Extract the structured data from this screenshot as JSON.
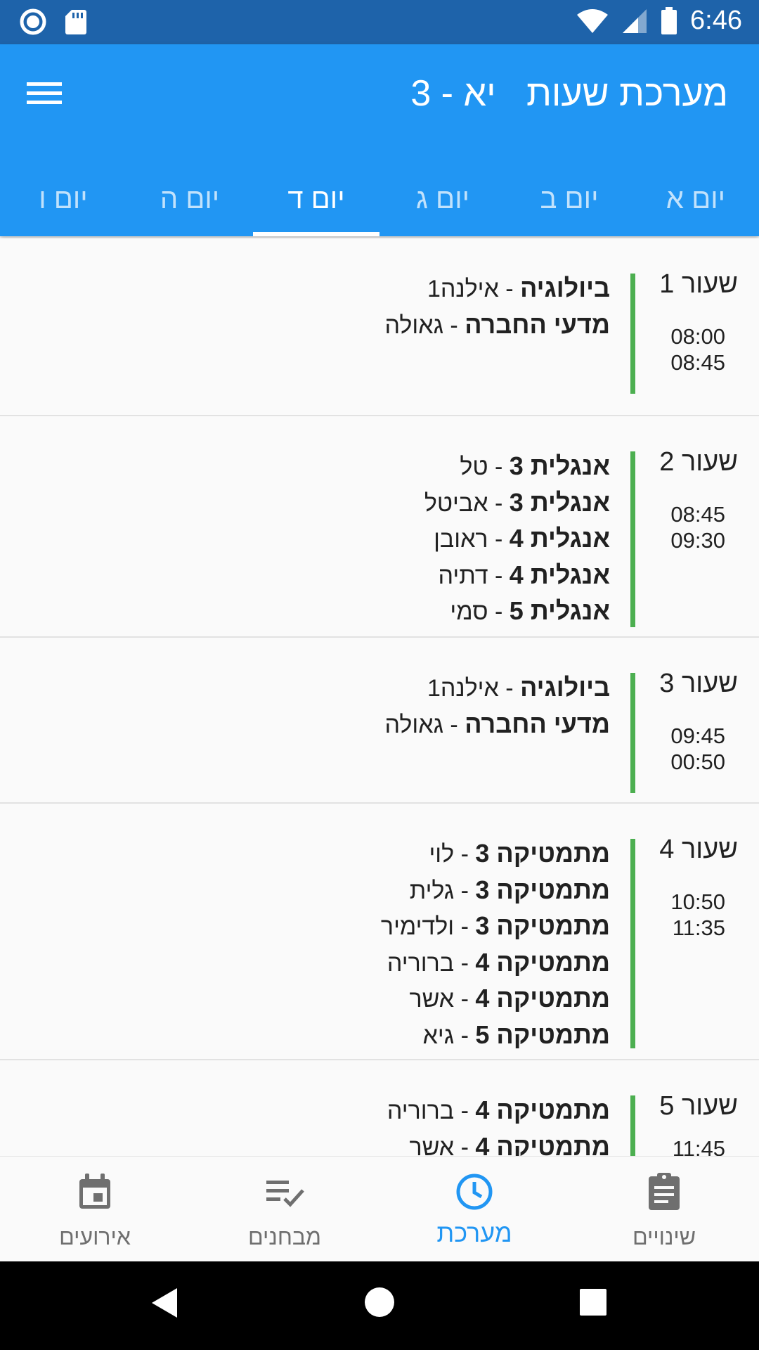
{
  "status_bar": {
    "time": "6:46"
  },
  "app_bar": {
    "title": "מערכת שעות   יא - 3"
  },
  "tabs": [
    {
      "label": "יום א"
    },
    {
      "label": "יום ב"
    },
    {
      "label": "יום ג"
    },
    {
      "label": "יום ד",
      "active": true
    },
    {
      "label": "יום ה"
    },
    {
      "label": "יום ו"
    }
  ],
  "periods": [
    {
      "label": "שעור 1",
      "start": "08:00",
      "end": "08:45",
      "lessons": [
        {
          "subject": "ביולוגיה",
          "sep": " - ",
          "teacher": "אילנה1"
        },
        {
          "subject": "מדעי החברה",
          "sep": " - ",
          "teacher": "גאולה"
        }
      ]
    },
    {
      "label": "שעור 2",
      "start": "08:45",
      "end": "09:30",
      "lessons": [
        {
          "subject": "אנגלית 3",
          "sep": " - ",
          "teacher": "טל"
        },
        {
          "subject": "אנגלית 3",
          "sep": " - ",
          "teacher": "אביטל"
        },
        {
          "subject": "אנגלית 4",
          "sep": " - ",
          "teacher": "ראובן"
        },
        {
          "subject": "אנגלית 4",
          "sep": " - ",
          "teacher": "דתיה"
        },
        {
          "subject": "אנגלית 5",
          "sep": " - ",
          "teacher": "סמי"
        }
      ]
    },
    {
      "label": "שעור 3",
      "start": "09:45",
      "end": "00:50",
      "lessons": [
        {
          "subject": "ביולוגיה",
          "sep": " - ",
          "teacher": "אילנה1"
        },
        {
          "subject": "מדעי החברה",
          "sep": " - ",
          "teacher": "גאולה"
        }
      ]
    },
    {
      "label": "שעור 4",
      "start": "10:50",
      "end": "11:35",
      "lessons": [
        {
          "subject": "מתמטיקה 3",
          "sep": " - ",
          "teacher": "לוי"
        },
        {
          "subject": "מתמטיקה 3",
          "sep": " - ",
          "teacher": "גלית"
        },
        {
          "subject": "מתמטיקה 3",
          "sep": " - ",
          "teacher": "ולדימיר"
        },
        {
          "subject": "מתמטיקה 4",
          "sep": " - ",
          "teacher": "ברוריה"
        },
        {
          "subject": "מתמטיקה 4",
          "sep": " - ",
          "teacher": "אשר"
        },
        {
          "subject": "מתמטיקה 5",
          "sep": " - ",
          "teacher": "גיא"
        }
      ]
    },
    {
      "label": "שעור 5",
      "start": "11:45",
      "end": "",
      "lessons": [
        {
          "subject": "מתמטיקה 4",
          "sep": " - ",
          "teacher": "ברוריה"
        },
        {
          "subject": "מתמטיקה 4",
          "sep": " - ",
          "teacher": "אשר"
        }
      ]
    }
  ],
  "bottom_nav": [
    {
      "label": "אירועים",
      "icon": "calendar-icon"
    },
    {
      "label": "מבחנים",
      "icon": "checklist-icon"
    },
    {
      "label": "מערכת",
      "icon": "clock-icon",
      "active": true
    },
    {
      "label": "שינויים",
      "icon": "clipboard-icon"
    }
  ],
  "colors": {
    "app_bar": "#2196f3",
    "status_bar": "#1e63aa",
    "period_bar": "#4caf50",
    "active_nav": "#2196f3"
  }
}
